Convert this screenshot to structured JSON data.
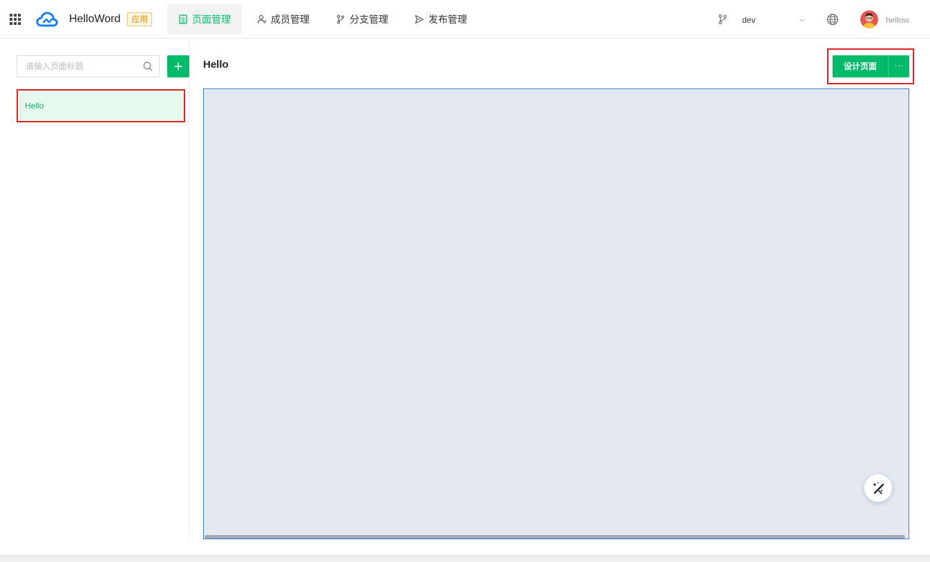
{
  "header": {
    "app_name": "HelloWord",
    "app_tag": "应用",
    "nav": [
      {
        "label": "页面管理",
        "icon": "page-icon",
        "active": true
      },
      {
        "label": "成员管理",
        "icon": "members-icon",
        "active": false
      },
      {
        "label": "分支管理",
        "icon": "branch-icon",
        "active": false
      },
      {
        "label": "发布管理",
        "icon": "send-icon",
        "active": false
      }
    ],
    "branch": {
      "selected": "dev"
    },
    "user": {
      "name": "hellow"
    }
  },
  "sidebar": {
    "search": {
      "placeholder": "请输入页面标题",
      "value": ""
    },
    "pages": [
      {
        "label": "Hello",
        "selected": true
      }
    ]
  },
  "main": {
    "title": "Hello",
    "design_button_label": "设计页面",
    "more_button_label": "···"
  },
  "colors": {
    "accent": "#00b96b",
    "highlight": "#e02020",
    "canvas_bg": "#e2e9f3"
  }
}
